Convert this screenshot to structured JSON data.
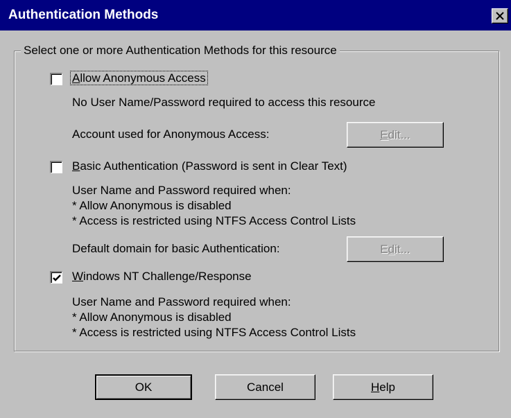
{
  "window": {
    "title": "Authentication Methods"
  },
  "group": {
    "label": "Select one or more Authentication Methods for this resource"
  },
  "options": [
    {
      "label_prefix": "",
      "label_mnemonic": "A",
      "label_rest": "llow Anonymous Access",
      "checked": false,
      "desc": "No User Name/Password required to access this resource",
      "account_label": "Account used for Anonymous Access:",
      "edit_prefix": "",
      "edit_mnemonic": "E",
      "edit_rest": "dit..."
    },
    {
      "label_prefix": "",
      "label_mnemonic": "B",
      "label_rest": "asic Authentication (Password is sent in Clear Text)",
      "checked": false,
      "desc_lines": [
        "User Name and Password required when:",
        "* Allow Anonymous is disabled",
        "* Access is restricted using NTFS Access Control Lists"
      ],
      "domain_label": "Default domain for basic Authentication:",
      "edit_prefix": "E",
      "edit_mnemonic": "d",
      "edit_rest": "it..."
    },
    {
      "label_prefix": "",
      "label_mnemonic": "W",
      "label_rest": "indows NT Challenge/Response",
      "checked": true,
      "desc_lines": [
        "User Name and Password required when:",
        "* Allow Anonymous is disabled",
        "* Access is restricted using NTFS Access Control Lists"
      ]
    }
  ],
  "buttons": {
    "ok": "OK",
    "cancel": "Cancel",
    "help_mnemonic": "H",
    "help_rest": "elp"
  }
}
